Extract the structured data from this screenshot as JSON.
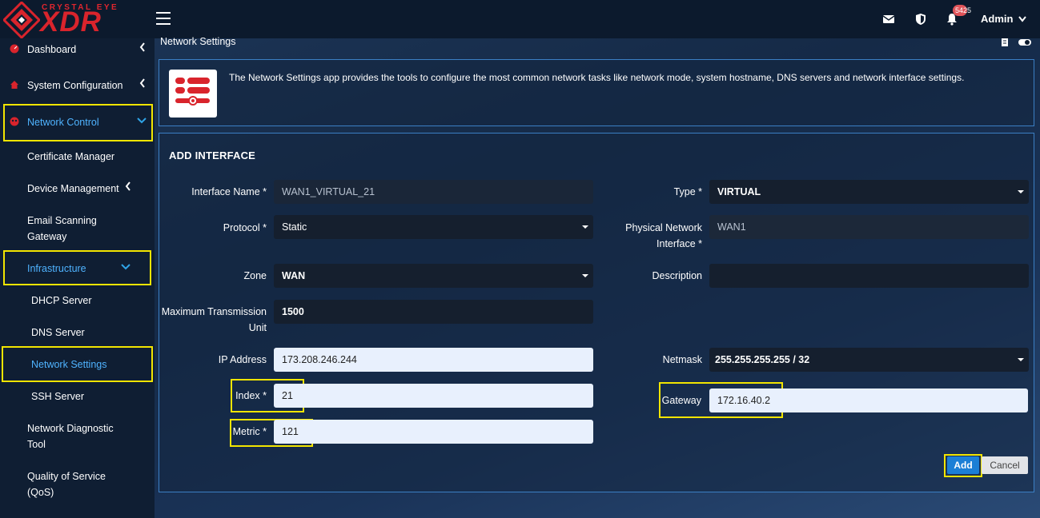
{
  "brand": {
    "top_text": "CRYSTAL EYE",
    "main_text": "XDR",
    "accent": "#d9242c"
  },
  "header": {
    "notification_count": "5425",
    "notification_badge": "54",
    "notification_suffix": "25",
    "user": "Admin"
  },
  "sidebar": {
    "items": [
      {
        "label": "Dashboard"
      },
      {
        "label": "System Configuration"
      },
      {
        "label": "Network Control"
      },
      {
        "label": "Certificate Manager"
      },
      {
        "label": "Device Management"
      },
      {
        "label": "Email Scanning"
      },
      {
        "label": "Gateway"
      },
      {
        "label": "Infrastructure"
      },
      {
        "label": "DHCP Server"
      },
      {
        "label": "DNS Server"
      },
      {
        "label": "Network Settings"
      },
      {
        "label": "SSH Server"
      },
      {
        "label": "Network Diagnostic"
      },
      {
        "label": "Tool"
      },
      {
        "label": "Quality of Service"
      },
      {
        "label": "(QoS)"
      }
    ]
  },
  "page": {
    "title": "Network Settings",
    "description": "The Network Settings app provides the tools to configure the most common network tasks like network mode, system hostname, DNS servers and network interface settings."
  },
  "form": {
    "title": "ADD INTERFACE",
    "interface_name": {
      "label": "Interface Name *",
      "value": "WAN1_VIRTUAL_21"
    },
    "type": {
      "label": "Type *",
      "value": "VIRTUAL"
    },
    "protocol": {
      "label": "Protocol *",
      "value": "Static"
    },
    "physical_network_interface": {
      "label1": "Physical Network",
      "label2": "Interface *",
      "value": "WAN1"
    },
    "zone": {
      "label": "Zone",
      "value": "WAN"
    },
    "description": {
      "label": "Description",
      "value": ""
    },
    "mtu": {
      "label1": "Maximum Transmission",
      "label2": "Unit",
      "value": "1500"
    },
    "ip_address": {
      "label": "IP Address",
      "value": "173.208.246.244"
    },
    "netmask": {
      "label": "Netmask",
      "value": "255.255.255.255 / 32"
    },
    "index": {
      "label": "Index *",
      "value": "21"
    },
    "gateway": {
      "label": "Gateway",
      "value": "172.16.40.2"
    },
    "metric": {
      "label": "Metric *",
      "value": "121"
    },
    "add_label": "Add",
    "cancel_label": "Cancel"
  },
  "colors": {
    "highlight": "#f2e500",
    "active_link": "#4fb3ff",
    "panel_border": "#3b7fc4",
    "add_button": "#1b7fd6"
  }
}
